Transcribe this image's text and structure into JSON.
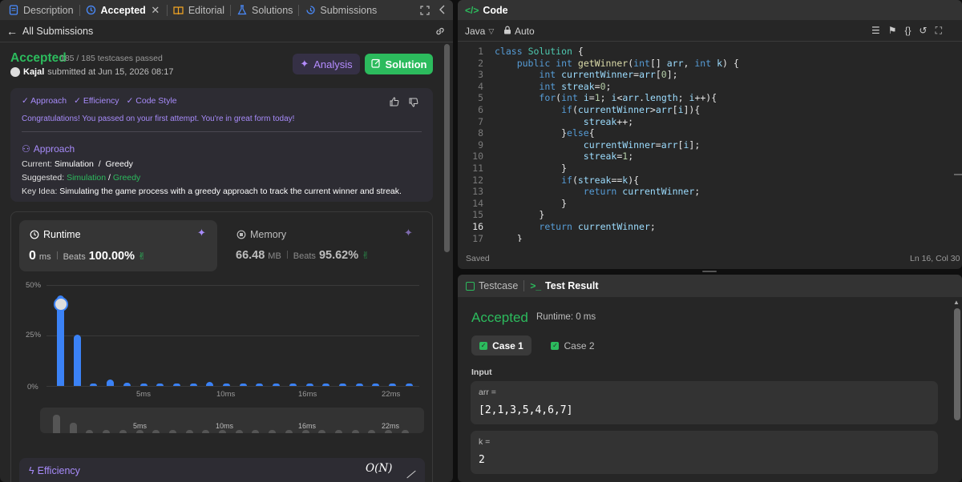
{
  "left_panel": {
    "tabs": [
      {
        "label": "Description",
        "icon": "description-icon"
      },
      {
        "label": "Accepted",
        "icon": "history-icon",
        "active": true
      },
      {
        "label": "Editorial",
        "icon": "book-icon"
      },
      {
        "label": "Solutions",
        "icon": "flask-icon"
      },
      {
        "label": "Submissions",
        "icon": "submissions-icon"
      }
    ],
    "back_label": "All Submissions",
    "status": "Accepted",
    "testcases": "185 / 185 testcases passed",
    "user": "Kajal",
    "submitted_at": "submitted at Jun 15, 2026 08:17",
    "analysis_label": "Analysis",
    "solution_label": "Solution",
    "analysis": {
      "tags": [
        "Approach",
        "Efficiency",
        "Code Style"
      ],
      "message": "Congratulations! You passed on your first attempt. You're in great form today!",
      "approach_heading": "Approach",
      "current_label": "Current:",
      "current_value": "Simulation  /  Greedy",
      "suggested_label": "Suggested:",
      "suggested_a": "Simulation",
      "suggested_sep": "/",
      "suggested_b": "Greedy",
      "keyidea_label": "Key Idea:",
      "keyidea_value": "Simulating the game process with a greedy approach to track the current winner and streak."
    },
    "runtime": {
      "label": "Runtime",
      "value": "0",
      "unit": "ms",
      "beats_label": "Beats",
      "beats": "100.00%"
    },
    "memory": {
      "label": "Memory",
      "value": "66.48",
      "unit": "MB",
      "beats_label": "Beats",
      "beats": "95.62%"
    },
    "efficiency": {
      "label": "Efficiency",
      "complexity": "O(N)"
    }
  },
  "chart_data": {
    "type": "bar",
    "title": "",
    "xlabel": "",
    "ylabel": "",
    "ylim": [
      0,
      50
    ],
    "yticks": [
      "50%",
      "25%",
      "0%"
    ],
    "xticks": [
      "5ms",
      "10ms",
      "22ms",
      "16ms"
    ],
    "xtick_labels": [
      "5ms",
      "10ms",
      "16ms",
      "22ms"
    ],
    "x": [
      0,
      1,
      2,
      3,
      4,
      5,
      6,
      7,
      8,
      9,
      10,
      11,
      12,
      13,
      14,
      15,
      16,
      17,
      18,
      19,
      20,
      21
    ],
    "values": [
      45,
      25.5,
      1,
      3,
      1.5,
      1,
      1,
      1,
      1,
      2,
      1,
      1,
      1,
      1,
      1,
      1,
      1,
      1,
      1,
      1,
      1,
      1
    ],
    "highlight_index": 0,
    "colors": {
      "bar": "#3b82f6",
      "minimap_bar": "#555555"
    }
  },
  "code_panel": {
    "title": "Code",
    "language": "Java",
    "mode": "Auto",
    "status": "Saved",
    "cursor": "Ln 16, Col 30",
    "lines": [
      {
        "n": "1",
        "html": "<span class='kw'>class</span> <span class='ty'>Solution</span> {"
      },
      {
        "n": "2",
        "html": "    <span class='kw'>public</span> <span class='kw'>int</span> <span class='fn'>getWinner</span>(<span class='kw'>int</span>[] <span class='vr'>arr</span>, <span class='kw'>int</span> <span class='vr'>k</span>) {"
      },
      {
        "n": "3",
        "html": "        <span class='kw'>int</span> <span class='vr'>currentWinner</span>=<span class='vr'>arr</span>[<span class='nm'>0</span>];"
      },
      {
        "n": "4",
        "html": "        <span class='kw'>int</span> <span class='vr'>streak</span>=<span class='nm'>0</span>;"
      },
      {
        "n": "5",
        "html": "        <span class='kw'>for</span>(<span class='kw'>int</span> <span class='vr'>i</span>=<span class='nm'>1</span>; <span class='vr'>i</span>&lt;<span class='vr'>arr</span>.<span class='vr'>length</span>; <span class='vr'>i</span>++){"
      },
      {
        "n": "6",
        "html": "            <span class='kw'>if</span>(<span class='vr'>currentWinner</span>&gt;<span class='vr'>arr</span>[<span class='vr'>i</span>]){"
      },
      {
        "n": "7",
        "html": "                <span class='vr'>streak</span>++;"
      },
      {
        "n": "8",
        "html": "            }<span class='kw'>else</span>{"
      },
      {
        "n": "9",
        "html": "                <span class='vr'>currentWinner</span>=<span class='vr'>arr</span>[<span class='vr'>i</span>];"
      },
      {
        "n": "10",
        "html": "                <span class='vr'>streak</span>=<span class='nm'>1</span>;"
      },
      {
        "n": "11",
        "html": "            }"
      },
      {
        "n": "12",
        "html": "            <span class='kw'>if</span>(<span class='vr'>streak</span>==<span class='vr'>k</span>){"
      },
      {
        "n": "13",
        "html": "                <span class='kw'>return</span> <span class='vr'>currentWinner</span>;"
      },
      {
        "n": "14",
        "html": "            }"
      },
      {
        "n": "15",
        "html": "        }"
      },
      {
        "n": "16",
        "html": "        <span class='kw'>return</span> <span class='vr'>currentWinner</span>;"
      },
      {
        "n": "17",
        "html": "    }"
      }
    ]
  },
  "result_panel": {
    "testcase_tab": "Testcase",
    "result_tab": "Test Result",
    "status": "Accepted",
    "runtime": "Runtime: 0 ms",
    "case1": "Case 1",
    "case2": "Case 2",
    "input_label": "Input",
    "arr_label": "arr =",
    "arr_value": "[2,1,3,5,4,6,7]",
    "k_label": "k =",
    "k_value": "2"
  }
}
